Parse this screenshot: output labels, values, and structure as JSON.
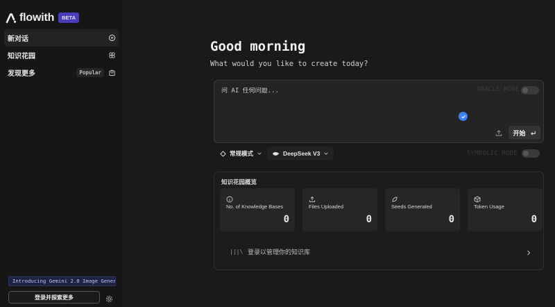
{
  "brand": {
    "name": "flowith",
    "badge": "BETA"
  },
  "sidebar": {
    "items": [
      {
        "label": "新对话",
        "icon": "chat-plus-icon"
      },
      {
        "label": "知识花园",
        "icon": "garden-icon"
      },
      {
        "label": "发现更多",
        "icon": "bag-icon",
        "badge": "Popular"
      }
    ],
    "announcement": "Introducing Gemini 2.0 Image Gener…",
    "login_label": "登录并探索更多",
    "settings_icon": "gear-icon"
  },
  "main": {
    "greeting": "Good morning",
    "subtitle": "What would you like to create today?",
    "composer": {
      "placeholder": "问 AI 任何问题...",
      "oracle_label": "ORACLE MODE",
      "start_label": "开始"
    },
    "options": {
      "mode_label": "常规模式",
      "model_label": "DeepSeek V3",
      "symbolic_label": "SYMBOLIC MODE"
    },
    "knowledge": {
      "title": "知识花园概览",
      "cards": [
        {
          "label": "No. of Knowledge Bases",
          "value": "0",
          "icon": "info-icon"
        },
        {
          "label": "Files Uploaded",
          "value": "0",
          "icon": "upload-icon"
        },
        {
          "label": "Seeds Generated",
          "value": "0",
          "icon": "seed-icon"
        },
        {
          "label": "Token Usage",
          "value": "0",
          "icon": "cube-icon"
        }
      ],
      "manage_icon_text": "|||\\",
      "manage_label": "登录以管理你的知识库"
    }
  },
  "colors": {
    "accent": "#4a3bb8",
    "check": "#3b82f6",
    "background": "#1a1a1a"
  }
}
